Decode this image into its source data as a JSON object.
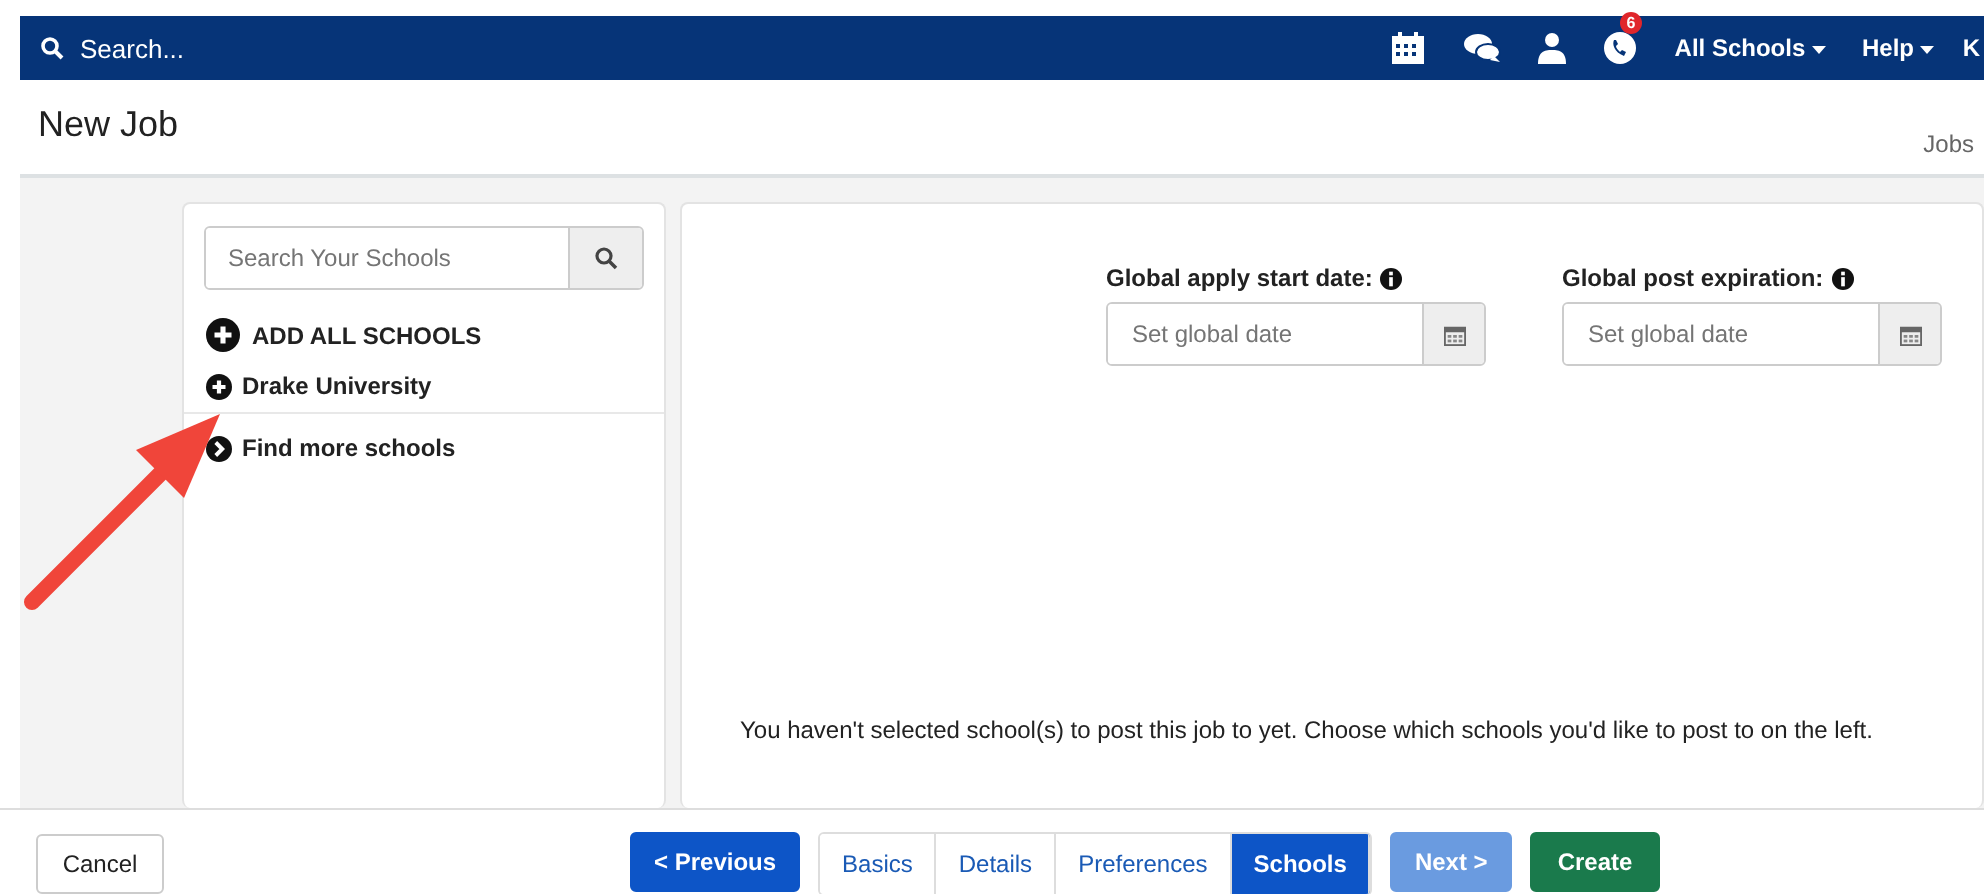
{
  "navbar": {
    "search_label": "Search...",
    "notification_count": "6",
    "menus": [
      {
        "label": "All Schools"
      },
      {
        "label": "Help"
      }
    ],
    "cut_label": "K"
  },
  "page": {
    "title": "New Job",
    "breadcrumb": "Jobs"
  },
  "school_panel": {
    "search": {
      "placeholder": "Search Your Schools"
    },
    "add_all": "ADD ALL SCHOOLS",
    "items": [
      {
        "kind": "add",
        "label": "Drake University"
      },
      {
        "kind": "link",
        "label": "Find more schools"
      }
    ]
  },
  "date_fields": [
    {
      "label": "Global apply start date:",
      "placeholder": "Set global date"
    },
    {
      "label": "Global post expiration:",
      "placeholder": "Set global date"
    }
  ],
  "message": "You haven't selected school(s) to post this job to yet. Choose which schools you'd like to post to on the left.",
  "annotation": {
    "kind": "arrow"
  },
  "footer": {
    "cancel": "Cancel",
    "previous": "< Previous",
    "steps": [
      {
        "label": "Basics",
        "selected": false
      },
      {
        "label": "Details",
        "selected": false
      },
      {
        "label": "Preferences",
        "selected": false
      },
      {
        "label": "Schools",
        "selected": true
      }
    ],
    "next": {
      "label": "Next >",
      "disabled": true
    },
    "create": "Create"
  }
}
